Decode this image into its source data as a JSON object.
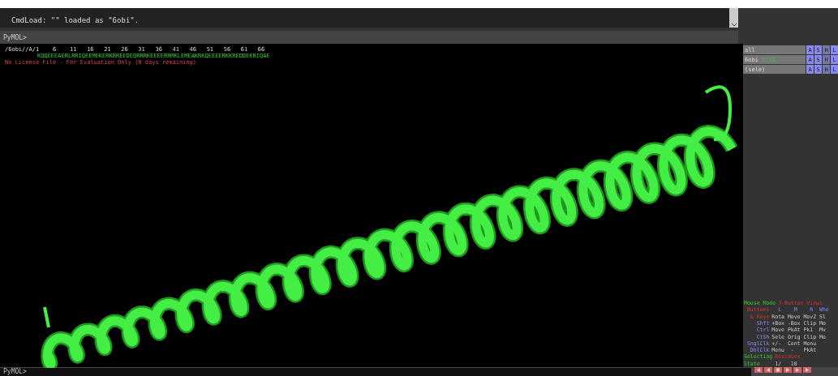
{
  "output": {
    "lines": [
      "CmdLoad: \"\" loaded as \"6obi\"."
    ]
  },
  "command_line": {
    "prompt": "PyMOL>"
  },
  "viewer": {
    "sequence_header": "/6obi//A/1    6    11   16   21   26   31   36   41   46   51   56   61   66",
    "sequence": "KQQEEEAERLRRIQEEMEKERKRREEDEQRRRKEEEERRMKLEMEAKRKQEEEERKKREDDEKRIQAE",
    "warning": "No License File - For Evaluation Only (0 days remaining)"
  },
  "objects": [
    {
      "name": "all",
      "buttons": [
        "A",
        "S",
        "H",
        "L"
      ]
    },
    {
      "name": "6obi",
      "state": "1/10",
      "buttons": [
        "A",
        "S",
        "H",
        "L"
      ]
    },
    {
      "name": "(sele)",
      "buttons": [
        "A",
        "S",
        "H",
        "L"
      ]
    }
  ],
  "mouse_mode": [
    [
      {
        "text": "Mouse Mode",
        "kind": "title"
      },
      {
        "text": "3-Button Viewi",
        "kind": "accent"
      }
    ],
    [
      {
        "text": " Buttons",
        "kind": "accent"
      },
      {
        "text": "  L    M    R  Whe",
        "kind": "key"
      }
    ],
    [
      {
        "text": "  & Keys",
        "kind": "accent"
      },
      {
        "text": "Rota Move MovZ Sl",
        "kind": "action"
      }
    ],
    [
      {
        "text": "    Shft",
        "kind": "key"
      },
      {
        "text": "+Box -Box Clip Mo",
        "kind": "action"
      }
    ],
    [
      {
        "text": "    Ctrl",
        "kind": "key"
      },
      {
        "text": "Move PkAt Pk1  Mv",
        "kind": "action"
      }
    ],
    [
      {
        "text": "    CtSh",
        "kind": "key"
      },
      {
        "text": "Sele Orig Clip Mo",
        "kind": "action"
      }
    ],
    [
      {
        "text": " SnglClk",
        "kind": "key"
      },
      {
        "text": "+/-  Cent Menu",
        "kind": "action"
      }
    ],
    [
      {
        "text": "  DblClk",
        "kind": "key"
      },
      {
        "text": "Menu  -   PkAt",
        "kind": "action"
      }
    ],
    [
      {
        "text": "Selecting",
        "kind": "title"
      },
      {
        "text": "Residues",
        "kind": "accent"
      }
    ],
    [
      {
        "text": "State",
        "kind": "title"
      },
      {
        "text": "    1/   10",
        "kind": "action"
      }
    ]
  ],
  "bottom_prompt": "PyMOL>"
}
